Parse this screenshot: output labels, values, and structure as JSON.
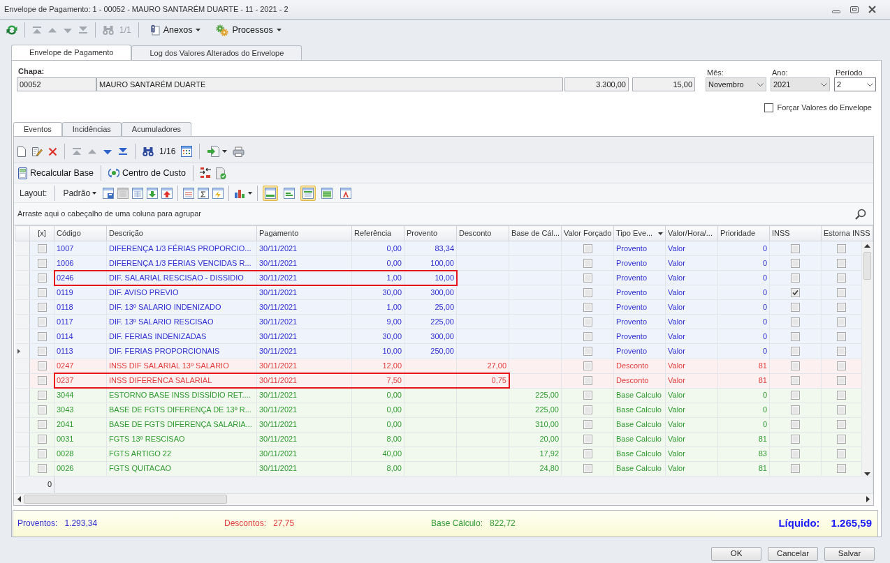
{
  "window": {
    "title": "Envelope de Pagamento: 1 - 00052 - MAURO SANTARÉM DUARTE - 11 - 2021 - 2"
  },
  "toolbar": {
    "nav": [
      {
        "kind": "first",
        "disabled": true
      },
      {
        "kind": "prev",
        "disabled": true
      },
      {
        "kind": "next",
        "disabled": true
      },
      {
        "kind": "last",
        "disabled": true
      }
    ],
    "search_disabled": true,
    "counter": "1/1",
    "menus": [
      {
        "kind": "clip",
        "label": "Anexos"
      },
      {
        "kind": "gears",
        "label": "Processos"
      }
    ]
  },
  "tabs": [
    {
      "label": "Envelope de Pagamento",
      "selected": true
    },
    {
      "label": "Log dos Valores Alterados do Envelope",
      "selected": false
    }
  ],
  "form": {
    "label": "Chapa:",
    "chapa": "00052",
    "name": "MAURO SANTARÉM DUARTE",
    "field_3": "3.300,00",
    "field_4": "15,00",
    "selects": [
      {
        "label": "Mês:",
        "value": "Novembro",
        "disabled": true
      },
      {
        "label": "Ano:",
        "value": "2021",
        "disabled": true
      },
      {
        "label": "Período",
        "value": "2",
        "disabled": false
      }
    ],
    "force_values": {
      "label": "Forçar Valores do Envelope",
      "checked": false
    }
  },
  "inner_tabs": [
    {
      "label": "Eventos",
      "selected": true
    },
    {
      "label": "Incidências",
      "selected": false
    },
    {
      "label": "Acumuladores",
      "selected": false
    }
  ],
  "grid_toolbar": {
    "nav": [
      {
        "kind": "first",
        "disabled": true
      },
      {
        "kind": "prev",
        "disabled": true
      },
      {
        "kind": "next",
        "disabled": false
      },
      {
        "kind": "last",
        "disabled": false
      }
    ],
    "search_disabled": false,
    "counter": "1/16"
  },
  "actions": [
    {
      "kind": "calc",
      "label": "Recalcular Base"
    },
    {
      "kind": "cost",
      "label": "Centro de Custo"
    }
  ],
  "layout_bar": {
    "label": "Layout:",
    "preset": "Padrão",
    "toggles": [
      {
        "pressed": true
      },
      {
        "pressed": false
      },
      {
        "pressed": true
      },
      {
        "pressed": false
      },
      {
        "pressed": false
      }
    ]
  },
  "group_panel": {
    "hint": "Arraste aqui o cabeçalho de uma coluna para agrupar"
  },
  "table": {
    "columns": [
      {
        "label": "[x]",
        "filter_button": false
      },
      {
        "label": "Código",
        "filter_button": false
      },
      {
        "label": "Descrição",
        "filter_button": false
      },
      {
        "label": "Pagamento",
        "filter_button": false
      },
      {
        "label": "Referência",
        "filter_button": false
      },
      {
        "label": "Provento",
        "filter_button": false
      },
      {
        "label": "Desconto",
        "filter_button": false
      },
      {
        "label": "Base de Cál...",
        "filter_button": false
      },
      {
        "label": "Valor Forçado",
        "filter_button": false
      },
      {
        "label": "Tipo Eve...",
        "filter_button": true
      },
      {
        "label": "Valor/Hora/...",
        "filter_button": false
      },
      {
        "label": "Prioridade",
        "filter_button": false
      },
      {
        "label": "INSS",
        "filter_button": false
      },
      {
        "label": "Estorna INSS",
        "filter_button": false
      }
    ],
    "rows": [
      {
        "kind": "provento",
        "selected": false,
        "highlighted": false,
        "checked": false,
        "codigo": "1007",
        "descricao": "DIFERENÇA 1/3 FÉRIAS PROPORCIO...",
        "pagamento": "30/11/2021",
        "referencia": "0,00",
        "provento": "83,34",
        "valor_forcado": false,
        "tipo": "Provento",
        "valor_hora": "Valor",
        "prioridade": "0",
        "inss": false,
        "estorna_inss": false
      },
      {
        "kind": "provento",
        "selected": false,
        "highlighted": false,
        "checked": false,
        "codigo": "1006",
        "descricao": "DIFERENÇA 1/3 FÉRIAS VENCIDAS R...",
        "pagamento": "30/11/2021",
        "referencia": "0,00",
        "provento": "100,00",
        "valor_forcado": false,
        "tipo": "Provento",
        "valor_hora": "Valor",
        "prioridade": "0",
        "inss": false,
        "estorna_inss": false
      },
      {
        "kind": "provento",
        "selected": false,
        "highlighted": true,
        "checked": false,
        "codigo": "0246",
        "descricao": "DIF. SALARIAL RESCISAO - DISSIDIO",
        "pagamento": "30/11/2021",
        "referencia": "1,00",
        "provento": "10,00",
        "valor_forcado": false,
        "tipo": "Provento",
        "valor_hora": "Valor",
        "prioridade": "0",
        "inss": false,
        "estorna_inss": false
      },
      {
        "kind": "provento",
        "selected": false,
        "highlighted": false,
        "checked": false,
        "codigo": "0119",
        "descricao": "DIF. AVISO PREVIO",
        "pagamento": "30/11/2021",
        "referencia": "30,00",
        "provento": "300,00",
        "valor_forcado": false,
        "tipo": "Provento",
        "valor_hora": "Valor",
        "prioridade": "0",
        "inss": true,
        "estorna_inss": false
      },
      {
        "kind": "provento",
        "selected": false,
        "highlighted": false,
        "checked": false,
        "codigo": "0118",
        "descricao": "DIF. 13º SALARIO INDENIZADO",
        "pagamento": "30/11/2021",
        "referencia": "1,00",
        "provento": "25,00",
        "valor_forcado": false,
        "tipo": "Provento",
        "valor_hora": "Valor",
        "prioridade": "0",
        "inss": false,
        "estorna_inss": false
      },
      {
        "kind": "provento",
        "selected": false,
        "highlighted": false,
        "checked": false,
        "codigo": "0117",
        "descricao": "DIF. 13º SALARIO RESCISAO",
        "pagamento": "30/11/2021",
        "referencia": "9,00",
        "provento": "225,00",
        "valor_forcado": false,
        "tipo": "Provento",
        "valor_hora": "Valor",
        "prioridade": "0",
        "inss": false,
        "estorna_inss": false
      },
      {
        "kind": "provento",
        "selected": false,
        "highlighted": false,
        "checked": false,
        "codigo": "0114",
        "descricao": "DIF. FERIAS INDENIZADAS",
        "pagamento": "30/11/2021",
        "referencia": "30,00",
        "provento": "300,00",
        "valor_forcado": false,
        "tipo": "Provento",
        "valor_hora": "Valor",
        "prioridade": "0",
        "inss": false,
        "estorna_inss": false
      },
      {
        "kind": "provento",
        "selected": true,
        "highlighted": false,
        "checked": false,
        "codigo": "0113",
        "descricao": "DIF. FERIAS PROPORCIONAIS",
        "pagamento": "30/11/2021",
        "referencia": "10,00",
        "provento": "250,00",
        "valor_forcado": false,
        "tipo": "Provento",
        "valor_hora": "Valor",
        "prioridade": "0",
        "inss": false,
        "estorna_inss": false
      },
      {
        "kind": "desconto",
        "selected": false,
        "highlighted": false,
        "checked": false,
        "codigo": "0247",
        "descricao": "INSS DIF SALARIAL 13º SALARIO",
        "pagamento": "30/11/2021",
        "referencia": "12,00",
        "desconto": "27,00",
        "valor_forcado": false,
        "tipo": "Desconto",
        "valor_hora": "Valor",
        "prioridade": "81",
        "inss": false,
        "estorna_inss": false
      },
      {
        "kind": "desconto",
        "selected": false,
        "highlighted": true,
        "checked": false,
        "codigo": "0237",
        "descricao": "INSS DIFERENCA SALARIAL",
        "pagamento": "30/11/2021",
        "referencia": "7,50",
        "desconto": "0,75",
        "valor_forcado": false,
        "tipo": "Desconto",
        "valor_hora": "Valor",
        "prioridade": "81",
        "inss": false,
        "estorna_inss": false
      },
      {
        "kind": "base",
        "selected": false,
        "highlighted": false,
        "checked": false,
        "codigo": "3044",
        "descricao": "ESTORNO BASE INSS DISSÍDIO RET....",
        "pagamento": "30/11/2021",
        "referencia": "0,00",
        "base": "225,00",
        "valor_forcado": false,
        "tipo": "Base Calculo",
        "valor_hora": "Valor",
        "prioridade": "0",
        "inss": false,
        "estorna_inss": false
      },
      {
        "kind": "base",
        "selected": false,
        "highlighted": false,
        "checked": false,
        "codigo": "3043",
        "descricao": "BASE DE FGTS DIFERENÇA DE 13º R...",
        "pagamento": "30/11/2021",
        "referencia": "0,00",
        "base": "225,00",
        "valor_forcado": false,
        "tipo": "Base Calculo",
        "valor_hora": "Valor",
        "prioridade": "0",
        "inss": false,
        "estorna_inss": false
      },
      {
        "kind": "base",
        "selected": false,
        "highlighted": false,
        "checked": false,
        "codigo": "2041",
        "descricao": "BASE DE FGTS DIFERENÇA SALARIA...",
        "pagamento": "30/11/2021",
        "referencia": "0,00",
        "base": "310,00",
        "valor_forcado": false,
        "tipo": "Base Calculo",
        "valor_hora": "Valor",
        "prioridade": "0",
        "inss": false,
        "estorna_inss": false
      },
      {
        "kind": "base",
        "selected": false,
        "highlighted": false,
        "checked": false,
        "codigo": "0031",
        "descricao": "FGTS 13º RESCISAO",
        "pagamento": "30/11/2021",
        "referencia": "8,00",
        "base": "20,00",
        "valor_forcado": false,
        "tipo": "Base Calculo",
        "valor_hora": "Valor",
        "prioridade": "81",
        "inss": false,
        "estorna_inss": false
      },
      {
        "kind": "base",
        "selected": false,
        "highlighted": false,
        "checked": false,
        "codigo": "0028",
        "descricao": "FGTS ARTIGO 22",
        "pagamento": "30/11/2021",
        "referencia": "40,00",
        "base": "17,92",
        "valor_forcado": false,
        "tipo": "Base Calculo",
        "valor_hora": "Valor",
        "prioridade": "83",
        "inss": false,
        "estorna_inss": false
      },
      {
        "kind": "base",
        "selected": false,
        "highlighted": false,
        "checked": false,
        "codigo": "0026",
        "descricao": "FGTS QUITACAO",
        "pagamento": "30/11/2021",
        "referencia": "8,00",
        "base": "24,80",
        "valor_forcado": false,
        "tipo": "Base Calculo",
        "valor_hora": "Valor",
        "prioridade": "81",
        "inss": false,
        "estorna_inss": false
      }
    ],
    "footer": "0"
  },
  "totals": [
    {
      "kind": "provento",
      "label": "Proventos:",
      "value": "1.293,34"
    },
    {
      "kind": "desconto",
      "label": "Descontos:",
      "value": "27,75"
    },
    {
      "kind": "base",
      "label": "Base Cálculo:",
      "value": "822,72"
    }
  ],
  "net": {
    "label": "Líquido:",
    "value": "1.265,59"
  },
  "buttons": [
    "OK",
    "Cancelar",
    "Salvar"
  ]
}
